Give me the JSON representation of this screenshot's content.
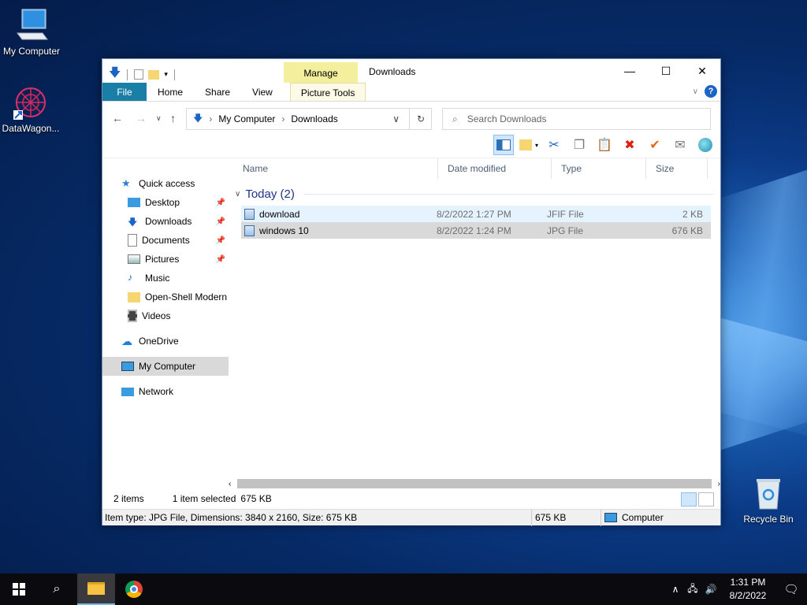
{
  "desktop": {
    "icons": [
      {
        "label": "My Computer",
        "icon": "computer-icon"
      },
      {
        "label": "DataWagon...",
        "icon": "datawagon-icon"
      },
      {
        "label": "Recycle Bin",
        "icon": "recycle-bin-icon"
      }
    ]
  },
  "window": {
    "title": "Downloads",
    "contextual_tab": "Manage",
    "ribbon_tabs": [
      "File",
      "Home",
      "Share",
      "View",
      "Picture Tools"
    ],
    "address": {
      "path": [
        "My Computer",
        "Downloads"
      ]
    },
    "search": {
      "placeholder": "Search Downloads"
    },
    "columns": [
      "Name",
      "Date modified",
      "Type",
      "Size"
    ],
    "group_label": "Today (2)",
    "files": [
      {
        "name": "download",
        "date": "8/2/2022 1:27 PM",
        "type": "JFIF File",
        "size": "2 KB"
      },
      {
        "name": "windows 10",
        "date": "8/2/2022 1:24 PM",
        "type": "JPG File",
        "size": "676 KB"
      }
    ],
    "nav": {
      "quick_access": "Quick access",
      "quick_items": [
        "Desktop",
        "Downloads",
        "Documents",
        "Pictures",
        "Music",
        "Open-Shell Modern",
        "Videos"
      ],
      "onedrive": "OneDrive",
      "my_computer": "My Computer",
      "network": "Network"
    },
    "status": {
      "items": "2 items",
      "selected": "1 item selected",
      "sel_size": "675 KB"
    },
    "details": {
      "info": "Item type: JPG File, Dimensions: 3840 x 2160, Size: 675 KB",
      "size": "675 KB",
      "location": "Computer"
    }
  },
  "taskbar": {
    "time": "1:31 PM",
    "date": "8/2/2022"
  },
  "colors": {
    "file_tab": "#1a7fa6",
    "manage_tab": "#f3ef9c",
    "selection": "#d9d9d9",
    "hover": "#e5f3ff"
  }
}
